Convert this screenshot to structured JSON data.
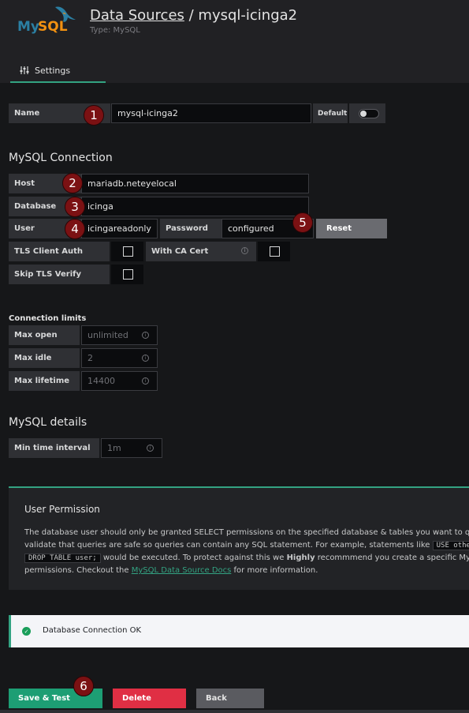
{
  "header": {
    "logo_text": "MySQL",
    "breadcrumb_link": "Data Sources",
    "separator": " / ",
    "title": "mysql-icinga2",
    "subtitle": "Type: MySQL"
  },
  "tabs": [
    {
      "label": "Settings",
      "icon": "sliders-icon",
      "active": true
    }
  ],
  "name_row": {
    "label": "Name",
    "value": "mysql-icinga2",
    "default_label": "Default",
    "default_on": false
  },
  "connection": {
    "heading": "MySQL Connection",
    "host_label": "Host",
    "host_value": "mariadb.neteyelocal",
    "database_label": "Database",
    "database_value": "icinga",
    "user_label": "User",
    "user_value": "icingareadonly",
    "password_label": "Password",
    "password_value": "configured",
    "reset_label": "Reset",
    "tls_client_auth_label": "TLS Client Auth",
    "with_ca_cert_label": "With CA Cert",
    "skip_tls_verify_label": "Skip TLS Verify"
  },
  "limits": {
    "heading": "Connection limits",
    "max_open_label": "Max open",
    "max_open_placeholder": "unlimited",
    "max_idle_label": "Max idle",
    "max_idle_placeholder": "2",
    "max_lifetime_label": "Max lifetime",
    "max_lifetime_placeholder": "14400"
  },
  "details": {
    "heading": "MySQL details",
    "min_interval_label": "Min time interval",
    "min_interval_placeholder": "1m"
  },
  "permission": {
    "title": "User Permission",
    "line1": "The database user should only be granted SELECT permissions on the specified database & tables you want to qu",
    "line2_a": "validate that queries are safe so queries can contain any SQL statement. For example, statements like ",
    "line2_code": "USE othe",
    "line3_code": "DROP TABLE user;",
    "line3_a": " would be executed. To protect against this we ",
    "line3_bold": "Highly",
    "line3_b": " recommmend you create a specific My",
    "line4_a": "permissions. Checkout the ",
    "line4_link": "MySQL Data Source Docs",
    "line4_b": " for more information."
  },
  "status": {
    "message": "Database Connection OK",
    "icon": "check-circle-icon"
  },
  "buttons": {
    "save_test": "Save & Test",
    "delete": "Delete",
    "back": "Back"
  },
  "badges": [
    "1",
    "2",
    "3",
    "4",
    "5",
    "6"
  ],
  "colors": {
    "accent": "#33a382",
    "save": "#1d9e74",
    "delete": "#e02f44",
    "back": "#5a5b60",
    "reset": "#6a6b70",
    "badge": "#7b1113"
  }
}
